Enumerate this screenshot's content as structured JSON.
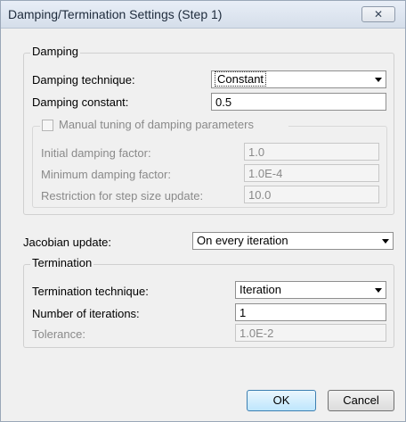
{
  "window": {
    "title": "Damping/Termination Settings (Step 1)",
    "close_glyph": "✕"
  },
  "damping": {
    "group_title": "Damping",
    "technique_label": "Damping technique:",
    "technique_value": "Constant",
    "constant_label": "Damping constant:",
    "constant_value": "0.5",
    "manual": {
      "checkbox_label": "Manual tuning of damping parameters",
      "checked": false,
      "initial_label": "Initial damping factor:",
      "initial_value": "1.0",
      "minimum_label": "Minimum damping factor:",
      "minimum_value": "1.0E-4",
      "restriction_label": "Restriction for step size update:",
      "restriction_value": "10.0"
    }
  },
  "jacobian": {
    "label": "Jacobian update:",
    "value": "On every iteration"
  },
  "termination": {
    "group_title": "Termination",
    "technique_label": "Termination technique:",
    "technique_value": "Iteration",
    "iterations_label": "Number of iterations:",
    "iterations_value": "1",
    "tolerance_label": "Tolerance:",
    "tolerance_value": "1.0E-2"
  },
  "buttons": {
    "ok": "OK",
    "cancel": "Cancel"
  }
}
